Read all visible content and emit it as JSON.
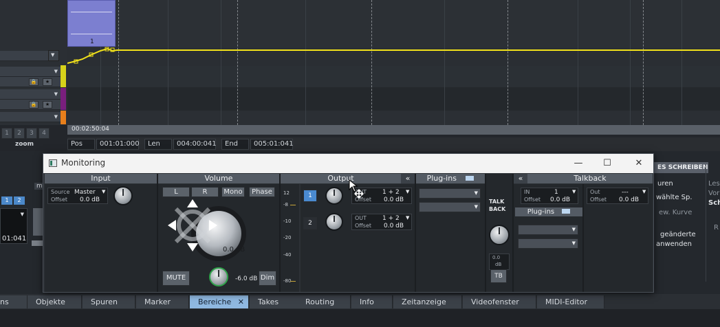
{
  "timeline": {
    "position_readout": "00:02:50:04",
    "pos_label": "Pos",
    "pos_value": "001:01:000",
    "len_label": "Len",
    "len_value": "004:00:041",
    "end_label": "End",
    "end_value": "005:01:041",
    "zoom_label": "zoom",
    "zoom_buttons": [
      "1",
      "2",
      "3",
      "4"
    ],
    "clip_label": "1"
  },
  "left_behind": {
    "buttons": [
      "1",
      "2"
    ],
    "value": "01:041",
    "cut_label": "ma"
  },
  "right_behind": {
    "header": "ES SCHREIBEN",
    "line1": "uren",
    "line2": "wählte Sp.",
    "line3": "ew. Kurve",
    "line4": "geänderte",
    "line5": "anwenden",
    "far1": "Les",
    "far2": "Vor",
    "far3": "Sch",
    "far4": "R"
  },
  "monitoring": {
    "title": "Monitoring",
    "window_controls": {
      "minimize": "—",
      "maximize": "☐",
      "close": "✕"
    },
    "input": {
      "header": "Input",
      "source_label": "Source",
      "source_value": "Master",
      "offset_label": "Offset",
      "offset_value": "0.0 dB"
    },
    "volume": {
      "header": "Volume",
      "btn_a": "L",
      "btn_b": "R",
      "mono": "Mono",
      "phase": "Phase",
      "knob_value": "0.0 dB",
      "mute": "MUTE",
      "dim_value": "-6.0 dB",
      "dim": "Dim"
    },
    "meter": {
      "labels": [
        "12",
        "-8",
        "-10",
        "-20",
        "-40",
        "-80"
      ]
    },
    "output": {
      "header": "Output",
      "collapse": "«",
      "channels": [
        {
          "num": "1",
          "dir": "OUT",
          "ch": "1 + 2",
          "offset_label": "Offset",
          "offset": "0.0 dB"
        },
        {
          "num": "2",
          "dir": "OUT",
          "ch": "1 + 2",
          "offset_label": "Offset",
          "offset": "0.0 dB"
        }
      ]
    },
    "plugins": {
      "header": "Plug-ins"
    },
    "talkback": {
      "label1": "TALK",
      "label2": "BACK",
      "level": "0.0",
      "unit": "dB",
      "tb": "TB"
    },
    "talkback_panel": {
      "collapse": "«",
      "header": "Talkback",
      "in_label": "IN",
      "in_value": "1",
      "in_offset_label": "Offset",
      "in_offset": "0.0 dB",
      "out_label": "Out",
      "out_value": "---",
      "out_offset_label": "Offset",
      "out_offset": "0.0 dB",
      "plugins_header": "Plug-ins"
    }
  },
  "tabs": [
    "ns",
    "Objekte",
    "Spuren",
    "Marker",
    "Bereiche",
    "Takes",
    "Routing",
    "Info",
    "Zeitanzeige",
    "Videofenster",
    "MIDI-Editor"
  ],
  "active_tab": "Bereiche",
  "colors": {
    "automation": "#f2e21b",
    "accent": "#4a8ad0",
    "active_tab": "#8fb8e0",
    "track_yellow": "#d7d21a",
    "track_purple": "#7a1f7d",
    "track_orange": "#e87f1b",
    "clip": "#7c7fd0"
  }
}
